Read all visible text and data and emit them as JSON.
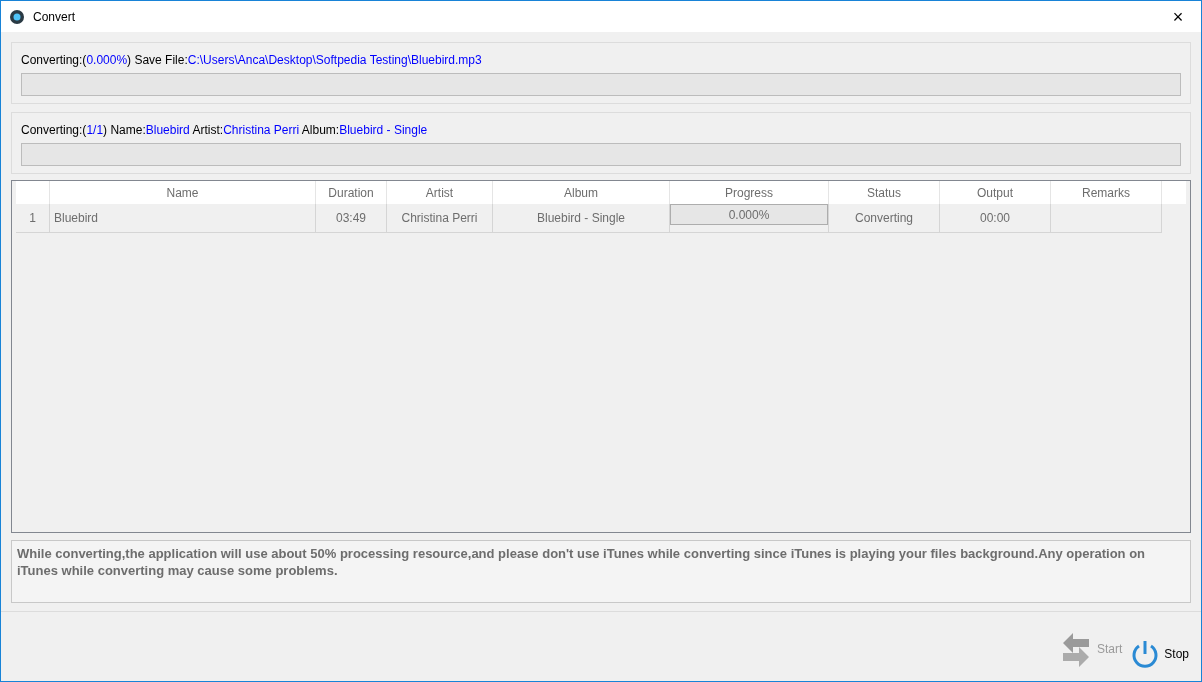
{
  "window": {
    "title": "Convert",
    "close": "×"
  },
  "file_status": {
    "parts": [
      {
        "kind": "label",
        "text": "Converting:("
      },
      {
        "kind": "value",
        "text": "0.000%"
      },
      {
        "kind": "label",
        "text": ") Save File:"
      },
      {
        "kind": "value",
        "text": "C:\\Users\\Anca\\Desktop\\Softpedia Testing\\Bluebird.mp3"
      }
    ],
    "level": 0
  },
  "batch_status": {
    "parts": [
      {
        "kind": "label",
        "text": "Converting:("
      },
      {
        "kind": "value",
        "text": "1/1"
      },
      {
        "kind": "label",
        "text": ") Name:"
      },
      {
        "kind": "value",
        "text": "Bluebird"
      },
      {
        "kind": "label",
        "text": " Artist:"
      },
      {
        "kind": "value",
        "text": "Christina Perri"
      },
      {
        "kind": "label",
        "text": " Album:"
      },
      {
        "kind": "value",
        "text": "Bluebird - Single"
      }
    ],
    "level": 0
  },
  "table": {
    "columns": [
      "Name",
      "Duration",
      "Artist",
      "Album",
      "Progress",
      "Status",
      "Output",
      "Remarks"
    ],
    "rows": [
      {
        "index": "1",
        "name": "Bluebird",
        "duration": "03:49",
        "artist": "Christina Perri",
        "album": "Bluebird - Single",
        "progress": "0.000%",
        "level": 0,
        "status": "Converting",
        "output": "00:00"
      }
    ]
  },
  "notice": "While converting,the application will use about 50% processing resource,and please don't use iTunes while converting since iTunes is playing your files background.Any operation on iTunes while converting may cause some problems.",
  "buttons": [
    {
      "kind": "start",
      "label": "Start",
      "disabled": true
    },
    {
      "kind": "stop",
      "label": "Stop",
      "disabled": false
    }
  ]
}
